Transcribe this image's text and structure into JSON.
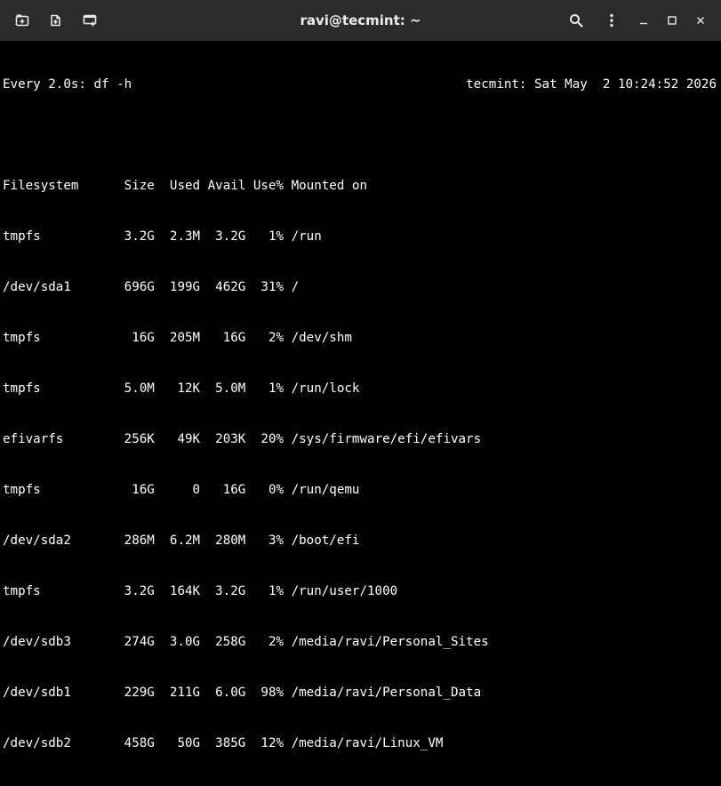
{
  "window": {
    "title": "ravi@tecmint: ~"
  },
  "toolbar": {
    "icons": [
      "new-tab-icon",
      "detach-tab-icon",
      "new-window-icon"
    ]
  },
  "controls": {
    "icons": [
      "search-icon",
      "menu-icon",
      "minimize-icon",
      "maximize-icon",
      "close-icon"
    ]
  },
  "terminal": {
    "watch_header": "Every 2.0s: df -h",
    "watch_host_time": "tecmint: Sat May  2 10:24:52 2026",
    "columns": [
      "Filesystem",
      "Size",
      "Used",
      "Avail",
      "Use%",
      "Mounted on"
    ],
    "header_line": "Filesystem      Size  Used Avail Use% Mounted on",
    "rows": [
      {
        "filesystem": "tmpfs",
        "size": "3.2G",
        "used": "2.3M",
        "avail": "3.2G",
        "use": "1%",
        "mount": "/run",
        "line": "tmpfs           3.2G  2.3M  3.2G   1% /run"
      },
      {
        "filesystem": "/dev/sda1",
        "size": "696G",
        "used": "199G",
        "avail": "462G",
        "use": "31%",
        "mount": "/",
        "line": "/dev/sda1       696G  199G  462G  31% /"
      },
      {
        "filesystem": "tmpfs",
        "size": "16G",
        "used": "205M",
        "avail": "16G",
        "use": "2%",
        "mount": "/dev/shm",
        "line": "tmpfs            16G  205M   16G   2% /dev/shm"
      },
      {
        "filesystem": "tmpfs",
        "size": "5.0M",
        "used": "12K",
        "avail": "5.0M",
        "use": "1%",
        "mount": "/run/lock",
        "line": "tmpfs           5.0M   12K  5.0M   1% /run/lock"
      },
      {
        "filesystem": "efivarfs",
        "size": "256K",
        "used": "49K",
        "avail": "203K",
        "use": "20%",
        "mount": "/sys/firmware/efi/efivars",
        "line": "efivarfs        256K   49K  203K  20% /sys/firmware/efi/efivars"
      },
      {
        "filesystem": "tmpfs",
        "size": "16G",
        "used": "0",
        "avail": "16G",
        "use": "0%",
        "mount": "/run/qemu",
        "line": "tmpfs            16G     0   16G   0% /run/qemu"
      },
      {
        "filesystem": "/dev/sda2",
        "size": "286M",
        "used": "6.2M",
        "avail": "280M",
        "use": "3%",
        "mount": "/boot/efi",
        "line": "/dev/sda2       286M  6.2M  280M   3% /boot/efi"
      },
      {
        "filesystem": "tmpfs",
        "size": "3.2G",
        "used": "164K",
        "avail": "3.2G",
        "use": "1%",
        "mount": "/run/user/1000",
        "line": "tmpfs           3.2G  164K  3.2G   1% /run/user/1000"
      },
      {
        "filesystem": "/dev/sdb3",
        "size": "274G",
        "used": "3.0G",
        "avail": "258G",
        "use": "2%",
        "mount": "/media/ravi/Personal_Sites",
        "line": "/dev/sdb3       274G  3.0G  258G   2% /media/ravi/Personal_Sites"
      },
      {
        "filesystem": "/dev/sdb1",
        "size": "229G",
        "used": "211G",
        "avail": "6.0G",
        "use": "98%",
        "mount": "/media/ravi/Personal_Data",
        "line": "/dev/sdb1       229G  211G  6.0G  98% /media/ravi/Personal_Data"
      },
      {
        "filesystem": "/dev/sdb2",
        "size": "458G",
        "used": "50G",
        "avail": "385G",
        "use": "12%",
        "mount": "/media/ravi/Linux_VM",
        "line": "/dev/sdb2       458G   50G  385G  12% /media/ravi/Linux_VM"
      }
    ]
  },
  "colors": {
    "titlebar_bg": "#2b2b2b",
    "terminal_bg": "#000000",
    "terminal_fg": "#ffffff",
    "title_fg": "#ececec"
  }
}
